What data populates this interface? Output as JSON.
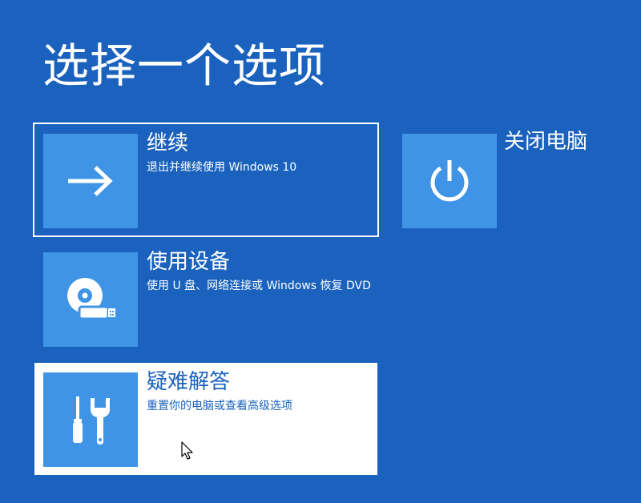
{
  "page": {
    "title": "选择一个选项"
  },
  "options": {
    "continue": {
      "title": "继续",
      "description": "退出并继续使用 Windows 10",
      "icon": "arrow-right-icon"
    },
    "use_device": {
      "title": "使用设备",
      "description": "使用 U 盘、网络连接或 Windows 恢复 DVD",
      "icon": "disc-usb-icon"
    },
    "troubleshoot": {
      "title": "疑难解答",
      "description": "重置你的电脑或查看高级选项",
      "icon": "tools-icon"
    },
    "shutdown": {
      "title": "关闭电脑",
      "icon": "power-icon"
    }
  },
  "colors": {
    "background": "#1a62bd",
    "tile": "#3f94e6",
    "text": "#ffffff"
  }
}
